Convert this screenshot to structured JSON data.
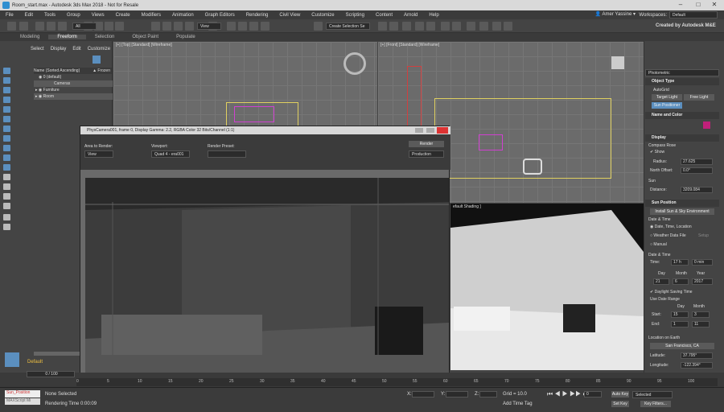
{
  "window": {
    "title": "Room_start.max - Autodesk 3ds Max 2018 - Not for Resale"
  },
  "menu": [
    "File",
    "Edit",
    "Tools",
    "Group",
    "Views",
    "Create",
    "Modifiers",
    "Animation",
    "Graph Editors",
    "Rendering",
    "Civil View",
    "Customize",
    "Scripting",
    "Content",
    "Arnold",
    "Help"
  ],
  "user": {
    "name": "Amer Yassine"
  },
  "workspace": {
    "label": "Workspaces:",
    "value": "Default"
  },
  "toolbar": {
    "selection_filter": "All",
    "view": "View",
    "selection_set": "Create Selection Se",
    "brand": "Created by Autodesk M&E"
  },
  "ribbon": {
    "tabs": [
      "Modeling",
      "Freeform",
      "Selection",
      "Object Paint",
      "Populate"
    ],
    "active": "Freeform"
  },
  "scene_explorer": {
    "tabs": [
      "Select",
      "Display",
      "Edit",
      "Customize"
    ],
    "header": "Name (Sorted Ascending)",
    "header2": "▲ Frozen",
    "items": [
      {
        "label": "0 (default)"
      },
      {
        "label": "Cameras"
      },
      {
        "label": "Furniture"
      },
      {
        "label": "Room"
      }
    ]
  },
  "viewports": {
    "top": "[+] [Top] [Standard] [Wireframe]",
    "front": "[+] [Front] [Standard] [Wireframe]",
    "persp": "efault Shading ]"
  },
  "render_window": {
    "title": "PhysCamera001, frame 0, Display Gamma: 2.2, RGBA Color 32 Bits/Channel (1:1)",
    "area_label": "Area to Render:",
    "area_value": "View",
    "viewport_label": "Viewport:",
    "viewport_value": "Quad 4 - era001",
    "preset_label": "Render Preset:",
    "preset_value": "",
    "render_button": "Render",
    "mode_value": "Production"
  },
  "command_panel": {
    "category": "Photometric",
    "object_type": {
      "title": "Object Type",
      "autogrid": "AutoGrid",
      "buttons": [
        "Target Light",
        "Free Light",
        "Sun Positioner"
      ]
    },
    "name_color": {
      "title": "Name and Color"
    },
    "display": {
      "title": "Display",
      "compass_rose": "Compass Rose",
      "show": "✔ Show",
      "radius_label": "Radius:",
      "radius_value": "27.625",
      "north_label": "North Offset:",
      "north_value": "0.0°",
      "sun_label": "Sun",
      "distance_label": "Distance:",
      "distance_value": "3209.084"
    },
    "sun_position": {
      "title": "Sun Position",
      "install_btn": "Install Sun & Sky Environment",
      "dt_label": "Date & Time",
      "r1": "Date, Time, Location",
      "r2": "Weather Data File",
      "setup": "Setup",
      "r3": "Manual",
      "dt2_label": "Date & Time",
      "time_label": "Time:",
      "hour": "17 h",
      "min": "0 min",
      "day_h": "Day",
      "month_h": "Month",
      "year_h": "Year",
      "day": "21",
      "month": "6",
      "year": "2017",
      "dst": "✔ Daylight Saving Time",
      "range": "Use Date Range",
      "day2": "Day",
      "month2": "Month",
      "start": "Start:",
      "sday": "15",
      "smon": "3",
      "end": "End:",
      "eday": "1",
      "emon": "11",
      "loc_label": "Location on Earth",
      "loc": "San Francisco, CA",
      "lat_label": "Latitude:",
      "lat": "37.795°",
      "lon_label": "Longitude:",
      "lon": "-122.394°"
    }
  },
  "timeline": {
    "frame": "0 / 100",
    "ticks": [
      "0",
      "5",
      "10",
      "15",
      "20",
      "25",
      "30",
      "35",
      "40",
      "45",
      "50",
      "55",
      "60",
      "65",
      "70",
      "75",
      "80",
      "85",
      "90",
      "95",
      "100"
    ]
  },
  "status": {
    "script": "Sun_Position",
    "script2": "MAXScript Mi",
    "selection": "None Selected",
    "render_time": "Rendering Time  0:00:09",
    "x": "X:",
    "y": "Y:",
    "z": "Z:",
    "grid": "Grid = 10.0",
    "time_tag": "Add Time Tag",
    "autokey": "Auto Key",
    "setkey": "Set Key",
    "selected": "Selected",
    "keyfilters": "Key Filters...",
    "frame_num": "0",
    "layer": "Default"
  }
}
